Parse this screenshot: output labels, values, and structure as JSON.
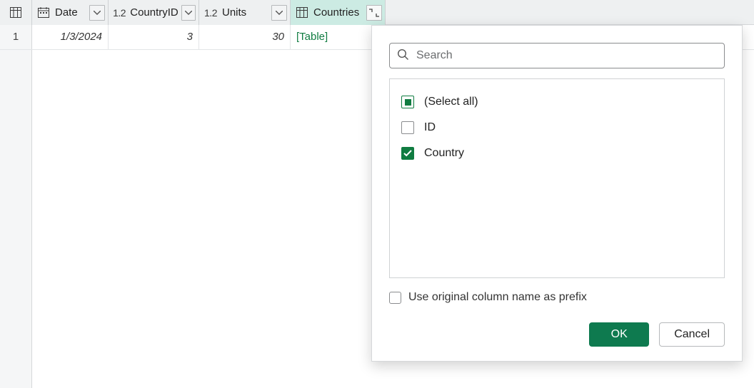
{
  "columns": {
    "date": {
      "name": "Date"
    },
    "countryId": {
      "name": "CountryID"
    },
    "units": {
      "name": "Units"
    },
    "countries": {
      "name": "Countries"
    }
  },
  "rows": [
    {
      "index": "1",
      "date": "1/3/2024",
      "countryId": "3",
      "units": "30",
      "countries": "[Table]"
    }
  ],
  "popup": {
    "search_placeholder": "Search",
    "options": {
      "select_all": "(Select all)",
      "id": "ID",
      "country": "Country"
    },
    "prefix_label": "Use original column name as prefix",
    "ok": "OK",
    "cancel": "Cancel"
  }
}
